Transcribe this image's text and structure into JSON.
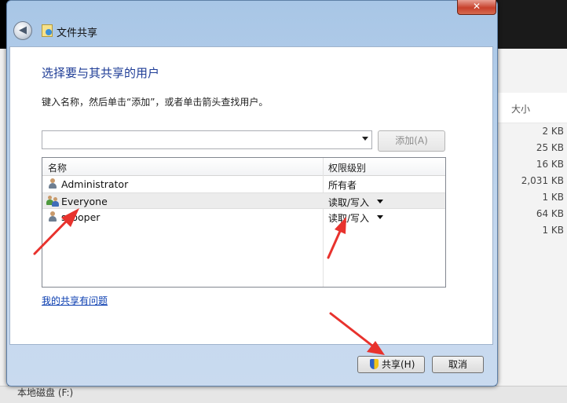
{
  "background": {
    "column_size_header": "大小",
    "file_sizes": [
      "2 KB",
      "25 KB",
      "16 KB",
      "2,031 KB",
      "1 KB",
      "64 KB",
      "1 KB"
    ],
    "bottom_drive_label": "本地磁盘 (F:)"
  },
  "dialog": {
    "title": "文件共享",
    "close_glyph": "✕",
    "back_glyph": "◀",
    "heading": "选择要与其共享的用户",
    "instruction": "键入名称，然后单击“添加”，或者单击箭头查找用户。",
    "name_input_value": "",
    "add_button_label": "添加(A)",
    "table": {
      "headers": {
        "name": "名称",
        "permission": "权限级别"
      },
      "rows": [
        {
          "name": "Administrator",
          "permission": "所有者",
          "icon": "user-icon"
        },
        {
          "name": "Everyone",
          "permission": "读取/写入",
          "icon": "group-icon"
        },
        {
          "name": "scooper",
          "permission": "读取/写入",
          "icon": "user-icon"
        }
      ]
    },
    "problem_link": "我的共享有问题",
    "share_button_label": "共享(H)",
    "cancel_button_label": "取消"
  },
  "colors": {
    "annotation_arrow": "#e8322d",
    "heading": "#1e3c96",
    "link": "#0a3db0"
  }
}
